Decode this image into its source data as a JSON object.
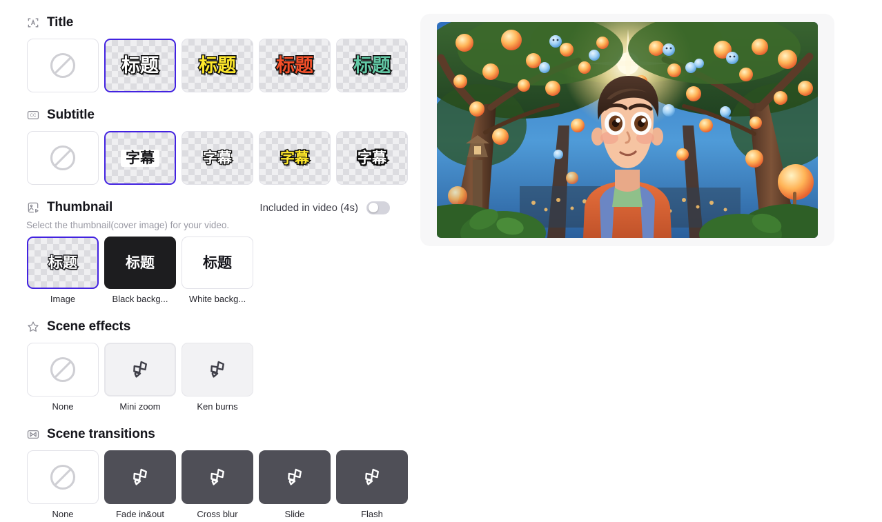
{
  "sections": {
    "title": {
      "icon": "title-frame-icon",
      "label": "Title",
      "options": [
        {
          "name": "none",
          "sample": "",
          "caption": ""
        },
        {
          "name": "white-outline",
          "sample": "标题",
          "caption": ""
        },
        {
          "name": "yellow-outline",
          "sample": "标题",
          "caption": ""
        },
        {
          "name": "red-outline",
          "sample": "标题",
          "caption": ""
        },
        {
          "name": "green-outline",
          "sample": "标题",
          "caption": ""
        }
      ],
      "selected_index": 1
    },
    "subtitle": {
      "icon": "closed-caption-icon",
      "label": "Subtitle",
      "options": [
        {
          "name": "none",
          "sample": ""
        },
        {
          "name": "plain-box",
          "sample": "字幕"
        },
        {
          "name": "white-thin-outline",
          "sample": "字幕"
        },
        {
          "name": "yellow-outline",
          "sample": "字幕"
        },
        {
          "name": "white-thick-outline",
          "sample": "字幕"
        }
      ],
      "selected_index": 1
    },
    "thumbnail": {
      "icon": "image-play-icon",
      "label": "Thumbnail",
      "included_label": "Included in video (4s)",
      "toggle_state": "off",
      "description": "Select the thumbnail(cover image) for your video.",
      "options": [
        {
          "name": "image",
          "sample": "标题",
          "caption": "Image"
        },
        {
          "name": "black-background",
          "sample": "标题",
          "caption": "Black backg..."
        },
        {
          "name": "white-background",
          "sample": "标题",
          "caption": "White backg..."
        }
      ],
      "selected_index": 0
    },
    "scene_effects": {
      "icon": "star-icon",
      "label": "Scene effects",
      "options": [
        {
          "name": "none",
          "caption": "None"
        },
        {
          "name": "mini-zoom",
          "caption": "Mini zoom"
        },
        {
          "name": "ken-burns",
          "caption": "Ken burns"
        }
      ],
      "selected_index": 1
    },
    "scene_transitions": {
      "icon": "transition-icon",
      "label": "Scene transitions",
      "options": [
        {
          "name": "none",
          "caption": "None"
        },
        {
          "name": "fade-in-out",
          "caption": "Fade in&out"
        },
        {
          "name": "cross-blur",
          "caption": "Cross blur"
        },
        {
          "name": "slide",
          "caption": "Slide"
        },
        {
          "name": "flash",
          "caption": "Flash"
        }
      ],
      "selected_index": 1
    }
  },
  "preview": {
    "name": "video-preview",
    "description": "3D animated boy with backpack looking up in a forest with glowing lanterns"
  },
  "colors": {
    "accent": "#4222e0",
    "card_grey": "#f2f2f4",
    "card_dark": "#4f4f57",
    "card_black": "#1d1d1f",
    "text": "#15151b",
    "muted": "#9a9aa4"
  }
}
